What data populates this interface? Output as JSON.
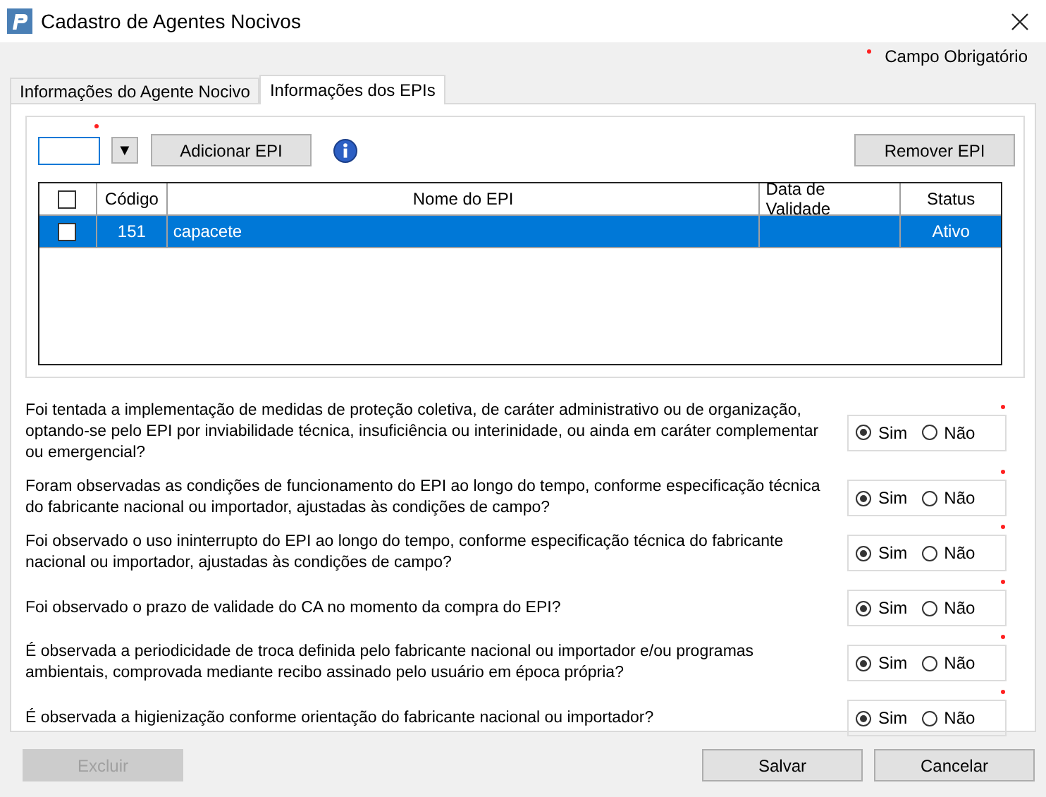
{
  "window": {
    "title": "Cadastro de Agentes Nocivos"
  },
  "legend": {
    "label": "Campo Obrigatório"
  },
  "tabs": [
    {
      "label": "Informações do Agente Nocivo",
      "selected": false
    },
    {
      "label": "Informações dos EPIs",
      "selected": true
    }
  ],
  "toolbar": {
    "dropdown_glyph": "▼",
    "add_button": "Adicionar EPI",
    "remove_button": "Remover EPI"
  },
  "table": {
    "header_checked": false,
    "columns": [
      "Código",
      "Nome do EPI",
      "Data de Validade",
      "Status"
    ],
    "rows": [
      {
        "selected": true,
        "checked": false,
        "cells": [
          "151",
          "capacete",
          "",
          "Ativo"
        ]
      }
    ]
  },
  "questions": [
    {
      "text": "Foi tentada a implementação de medidas de proteção coletiva, de caráter administrativo ou de organização, optando-se pelo EPI por inviabilidade técnica, insuficiência ou interinidade, ou ainda em caráter complementar ou emergencial?",
      "options": [
        {
          "label": "Sim",
          "selected": true
        },
        {
          "label": "Não",
          "selected": false
        }
      ]
    },
    {
      "text": "Foram observadas as condições de funcionamento do EPI ao longo do tempo, conforme especificação técnica do fabricante nacional ou importador, ajustadas às condições de campo?",
      "options": [
        {
          "label": "Sim",
          "selected": true
        },
        {
          "label": "Não",
          "selected": false
        }
      ]
    },
    {
      "text": "Foi observado o uso ininterrupto do EPI ao longo do tempo, conforme especificação técnica do fabricante nacional ou importador, ajustadas às condições de campo?",
      "options": [
        {
          "label": "Sim",
          "selected": true
        },
        {
          "label": "Não",
          "selected": false
        }
      ]
    },
    {
      "text": "Foi observado o prazo de validade do CA no momento da compra do EPI?",
      "options": [
        {
          "label": "Sim",
          "selected": true
        },
        {
          "label": "Não",
          "selected": false
        }
      ]
    },
    {
      "text": "É observada a periodicidade de troca definida pelo fabricante nacional ou importador e/ou programas ambientais, comprovada mediante recibo assinado pelo usuário em época própria?",
      "options": [
        {
          "label": "Sim",
          "selected": true
        },
        {
          "label": "Não",
          "selected": false
        }
      ]
    },
    {
      "text": "É observada a higienização conforme orientação do fabricante nacional ou importador?",
      "options": [
        {
          "label": "Sim",
          "selected": true
        },
        {
          "label": "Não",
          "selected": false
        }
      ]
    }
  ],
  "buttons": [
    {
      "label": "Excluir",
      "disabled": true
    },
    {
      "label": "Salvar",
      "disabled": false
    },
    {
      "label": "Cancelar",
      "disabled": false
    }
  ]
}
